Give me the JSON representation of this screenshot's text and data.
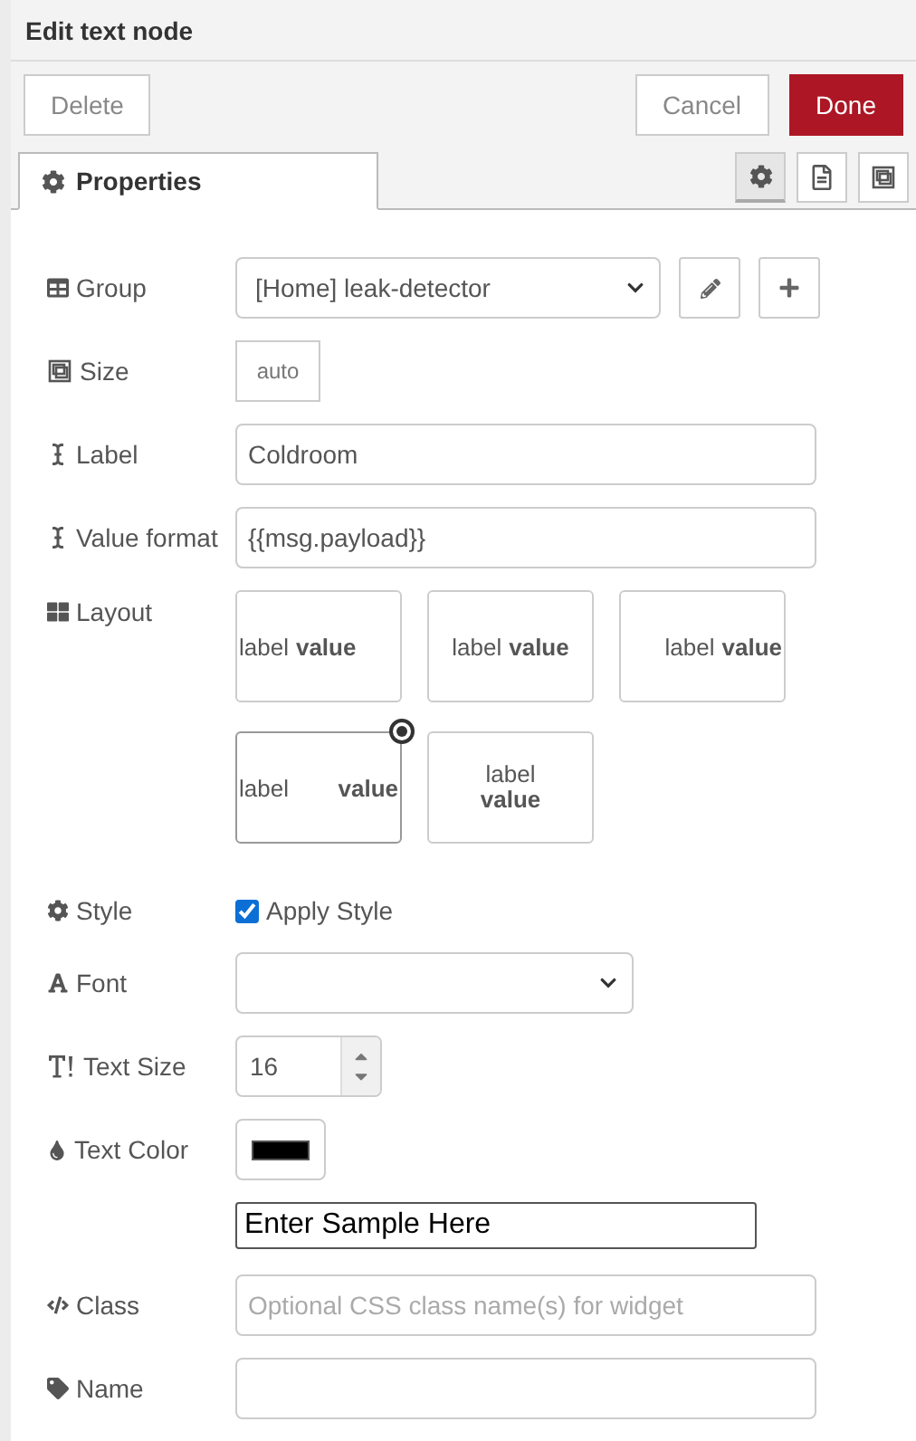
{
  "window": {
    "title": "Edit text node"
  },
  "buttons": [
    {
      "kind": "delete",
      "label": "Delete"
    },
    {
      "kind": "cancel",
      "label": "Cancel"
    },
    {
      "kind": "done",
      "label": "Done"
    }
  ],
  "tabs": [
    {
      "label": "Properties",
      "selected": true
    }
  ],
  "icon_tabs": [
    {
      "kind": "gear",
      "selected": true
    },
    {
      "kind": "document",
      "selected": false
    },
    {
      "kind": "frame",
      "selected": false
    }
  ],
  "form": {
    "group": {
      "label": "Group",
      "value": "[Home] leak-detector"
    },
    "size": {
      "label": "Size",
      "value": "auto"
    },
    "label": {
      "label": "Label",
      "value": "Coldroom"
    },
    "value_format": {
      "label": "Value format",
      "value": "{{msg.payload}}"
    },
    "layout": {
      "label": "Layout",
      "options": [
        {
          "kind": "left",
          "label": "label",
          "value": "value",
          "selected": false
        },
        {
          "kind": "center",
          "label": "label",
          "value": "value",
          "selected": false
        },
        {
          "kind": "right",
          "label": "label",
          "value": "value",
          "selected": false
        },
        {
          "kind": "spread",
          "label": "label",
          "value": "value",
          "selected": true
        },
        {
          "kind": "stacked",
          "label": "label",
          "value": "value",
          "selected": false
        }
      ]
    },
    "style": {
      "label": "Style",
      "checkbox_label": "Apply Style",
      "checked": true
    },
    "font": {
      "label": "Font"
    },
    "text_size": {
      "label": "Text Size",
      "value": "16"
    },
    "text_color": {
      "label": "Text Color",
      "color": "#000000"
    },
    "sample": {
      "value": "Enter Sample Here"
    },
    "class": {
      "label": "Class",
      "placeholder": "Optional CSS class name(s) for widget"
    },
    "name": {
      "label": "Name"
    }
  }
}
